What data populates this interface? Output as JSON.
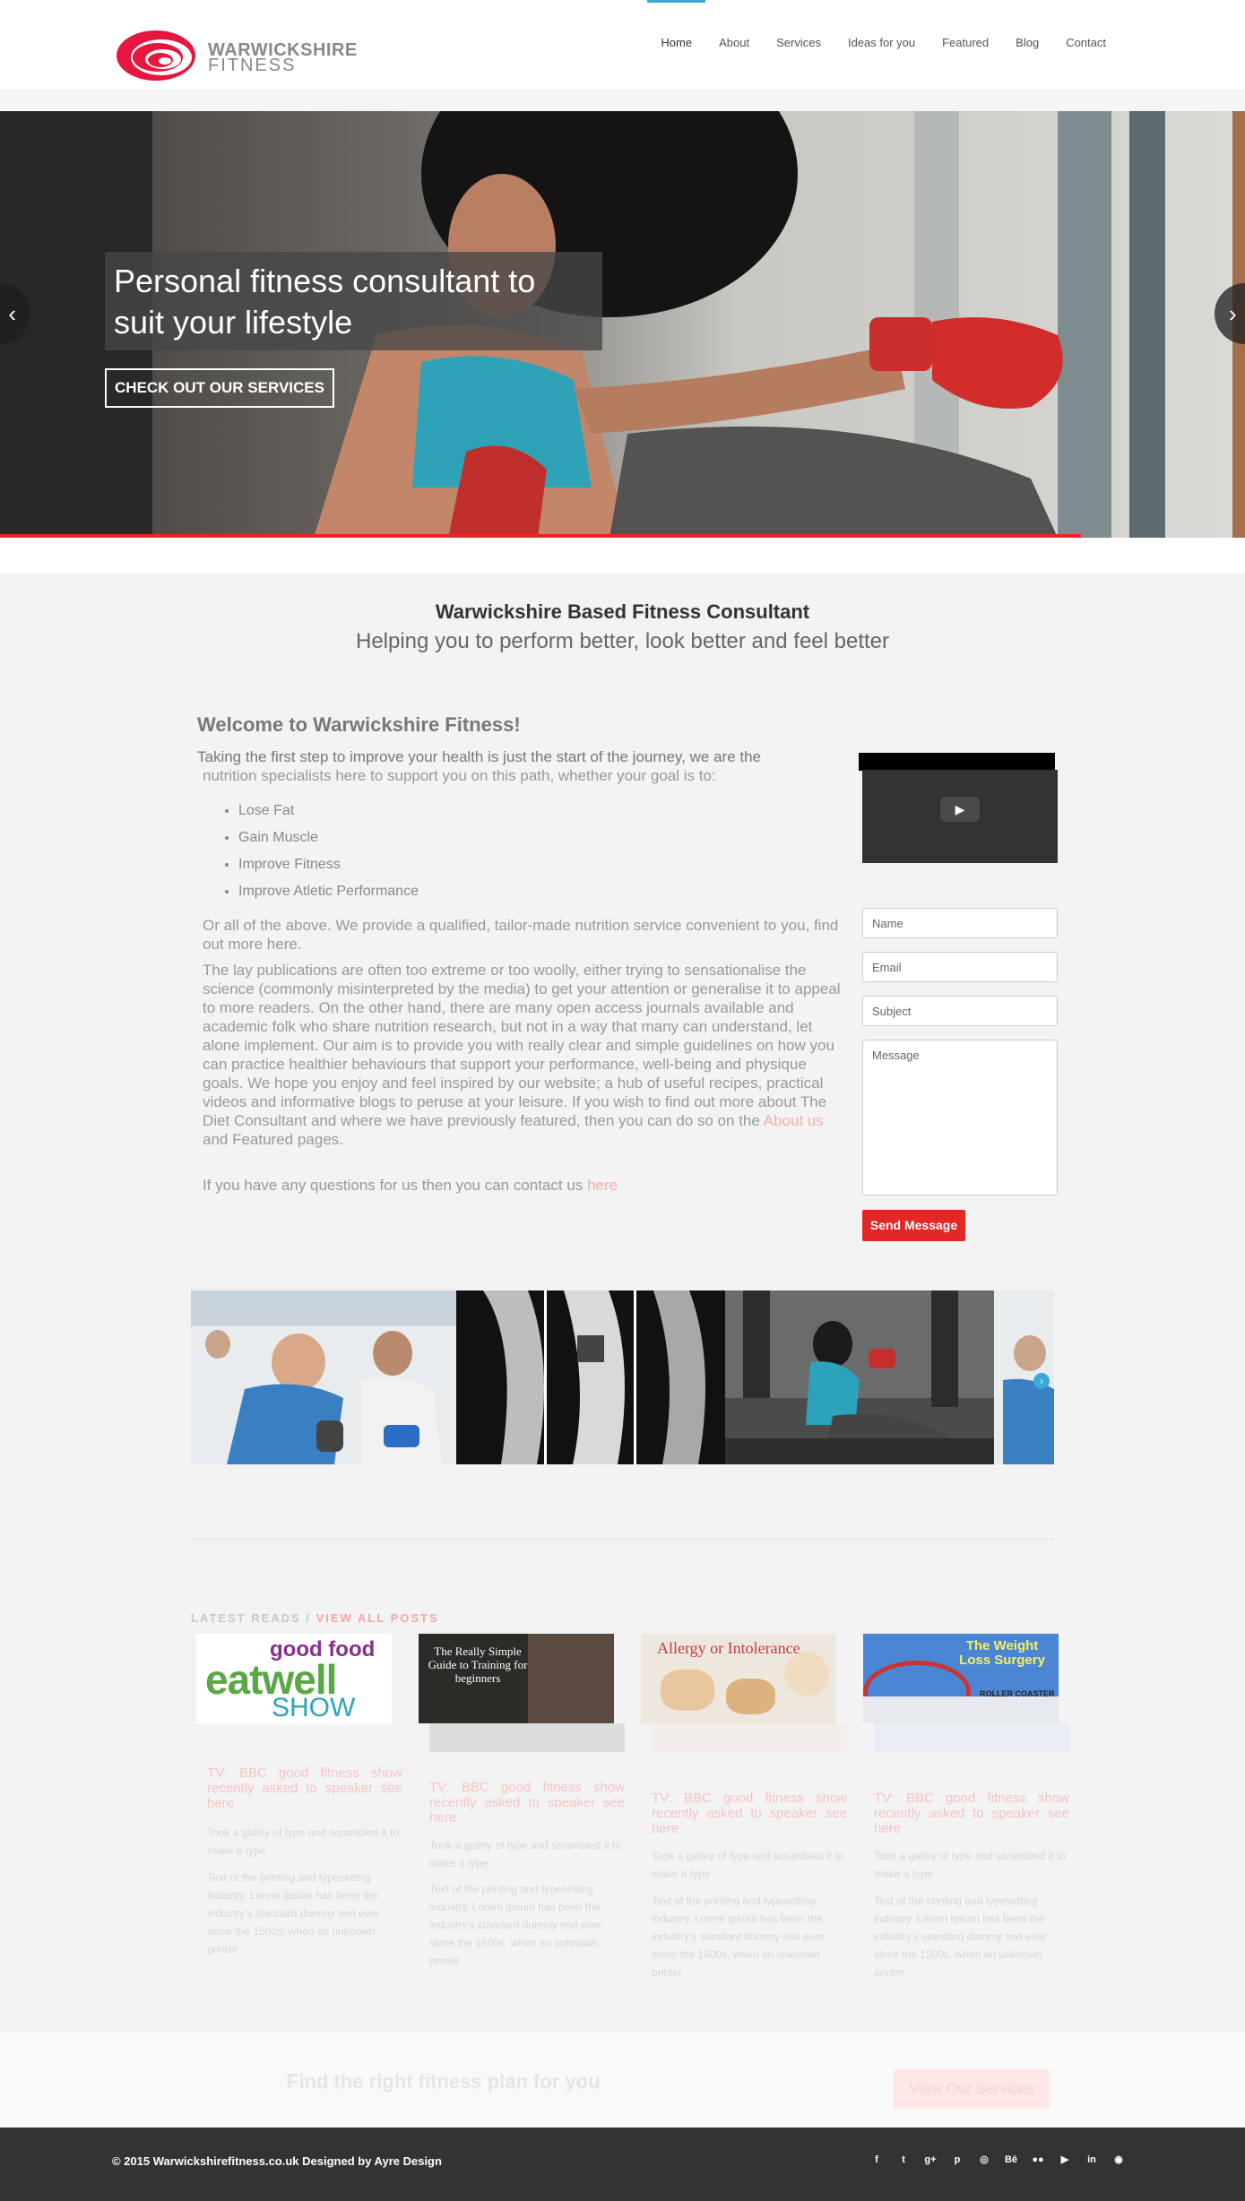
{
  "header": {
    "logo_line1": "WARWICKSHIRE",
    "logo_line2": "FITNESS",
    "nav": [
      "Home",
      "About",
      "Services",
      "Ideas for you",
      "Featured",
      "Blog",
      "Contact"
    ],
    "active": "Home"
  },
  "hero": {
    "caption": "Personal fitness consultant to suit your lifestyle",
    "button": "CHECK OUT OUR SERVICES",
    "prev_icon": "chevron-left-icon",
    "next_icon": "chevron-right-icon"
  },
  "intro": {
    "title": "Warwickshire Based Fitness Consultant",
    "subtitle": "Helping you to perform better, look better and feel better"
  },
  "welcome": {
    "heading": "Welcome to Warwickshire Fitness!",
    "lead_1": "Taking the first step to improve your health is just the start of the journey, we are the",
    "lead_2": "nutrition specialists here to support you on this path, whether your goal is to:",
    "goals": [
      "Lose Fat",
      "Gain Muscle",
      "Improve Fitness",
      "Improve Atletic Performance"
    ],
    "para1": "Or all of the above. We provide a qualified, tailor-made nutrition service convenient to you, find out more here.",
    "para2_start": "The lay publications are often too extreme or too woolly, either trying to sensationalise the science (commonly misinterpreted by the media) to get your attention or generalise it to appeal to more readers. On the other hand, there are many open access journals available and academic folk who share nutrition research, but not in a way that many can understand, let alone implement. Our aim is to provide you with really clear and simple guidelines on how you can practice healthier behaviours that support your performance, well-being and physique goals. We hope you enjoy and feel inspired by our website; a hub of useful recipes, practical videos and informative blogs to peruse at your leisure. If you wish to find out more about The Diet Consultant and where we have previously featured, then you can do so on the",
    "para2_link": "About us",
    "para2_end": "and Featured pages.",
    "para3_start": "If you have any questions for us then you can contact us",
    "para3_link": "here"
  },
  "form": {
    "name_placeholder": "Name",
    "email_placeholder": "Email",
    "subject_placeholder": "Subject",
    "message_placeholder": "Message",
    "send": "Send Message"
  },
  "reads": {
    "label": "LATEST READS /",
    "view_all": "VIEW ALL POSTS",
    "posts": [
      {
        "thumb_text_1": "good food",
        "thumb_text_2": "eatwell",
        "thumb_text_3": "SHOW",
        "title": "TV: BBC good fitness show recently asked to speaker see here",
        "meta": "Took a galley of type and scrambled it to make a type",
        "text": "Text of the printing and typesetting industry. Lorem Ipsum has been the industry's standard dummy text ever since the 1500s, when an unknown printer"
      },
      {
        "thumb_text_1": "The Really Simple Guide to Training for beginners",
        "title": "TV: BBC good fitness show recently asked to speaker see here",
        "meta": "Took a galley of type and scrambled it to make a type",
        "text": "Text of the printing and typesetting industry. Lorem Ipsum has been the industry's standard dummy text ever since the 1500s, when an unknown printer"
      },
      {
        "thumb_text_1": "Allergy or Intolerance",
        "title": "TV: BBC good fitness show recently asked to speaker see here",
        "meta": "Took a galley of type and scrambled it to make a type",
        "text": "Text of the printing and typesetting industry. Lorem Ipsum has been the industry's standard dummy text ever since the 1500s, when an unknown printer"
      },
      {
        "thumb_text_1": "The Weight Loss Surgery",
        "thumb_text_2": "ROLLER COASTER",
        "title": "TV: BBC good fitness show recently asked to speaker see here",
        "meta": "Took a galley of type and scrambled it to make a type",
        "text": "Text of the printing and typesetting industry. Lorem Ipsum has been the industry's standard dummy text ever since the 1500s, when an unknown printer"
      }
    ]
  },
  "cta": {
    "text": "Find the right fitness plan for you",
    "button": "View Our Services"
  },
  "footer": {
    "copyright": "© 2015 Warwickshirefitness.co.uk Designed by Ayre Design",
    "social": [
      {
        "icon": "facebook-icon",
        "glyph": "f"
      },
      {
        "icon": "twitter-icon",
        "glyph": "t"
      },
      {
        "icon": "google-plus-icon",
        "glyph": "g+"
      },
      {
        "icon": "pinterest-icon",
        "glyph": "p"
      },
      {
        "icon": "dribbble-icon",
        "glyph": "◎"
      },
      {
        "icon": "behance-icon",
        "glyph": "Bē"
      },
      {
        "icon": "flickr-icon",
        "glyph": "●●"
      },
      {
        "icon": "youtube-icon",
        "glyph": "▶"
      },
      {
        "icon": "linkedin-icon",
        "glyph": "in"
      },
      {
        "icon": "github-icon",
        "glyph": "◉"
      }
    ]
  },
  "colors": {
    "accent_red": "#e22727",
    "nav_active_blue": "#3ba9d6",
    "footer_bg": "#333333"
  }
}
